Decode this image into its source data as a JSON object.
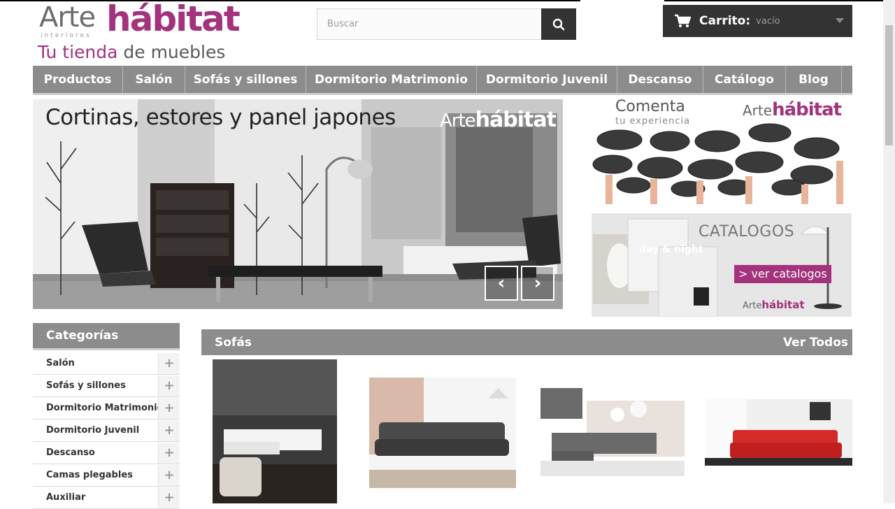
{
  "logo": {
    "brand_part1": "Arte",
    "brand_part2": "hábitat",
    "brand_small": "interiores",
    "tagline_part1": "Tu tienda",
    "tagline_part2": " de muebles"
  },
  "search": {
    "placeholder": "Buscar",
    "icon": "search-icon"
  },
  "cart": {
    "label": "Carrito:",
    "status": "vacío",
    "icon": "cart-icon"
  },
  "nav": {
    "items": [
      "Productos",
      "Salón",
      "Sofás y sillones",
      "Dormitorio Matrimonio",
      "Dormitorio Juvenil",
      "Descanso",
      "Catálogo",
      "Blog"
    ]
  },
  "banner": {
    "title": "Cortinas, estores y panel japones",
    "logo_part1": "Arte",
    "logo_part2": "hábitat",
    "prev_icon": "chevron-left-icon",
    "next_icon": "chevron-right-icon"
  },
  "promo_comment": {
    "title": "Comenta",
    "subtitle": "tu experiencia",
    "logo_part1": "Arte",
    "logo_part2": "hábitat"
  },
  "promo_catalog": {
    "title": "CATALOGOS",
    "cta": "> ver catalogos",
    "logo_part1": "Arte",
    "logo_part2": "hábitat",
    "book_label": "day & night"
  },
  "categories": {
    "heading": "Categorías",
    "items": [
      "Salón",
      "Sofás y sillones",
      "Dormitorio Matrimonio",
      "Dormitorio Juvenil",
      "Descanso",
      "Camas plegables",
      "Auxiliar"
    ]
  },
  "sofas_section": {
    "title": "Sofás",
    "view_all": "Ver Todos"
  },
  "colors": {
    "brand": "#a2337c",
    "nav_bg": "#8c8c8c",
    "dark": "#333333"
  }
}
